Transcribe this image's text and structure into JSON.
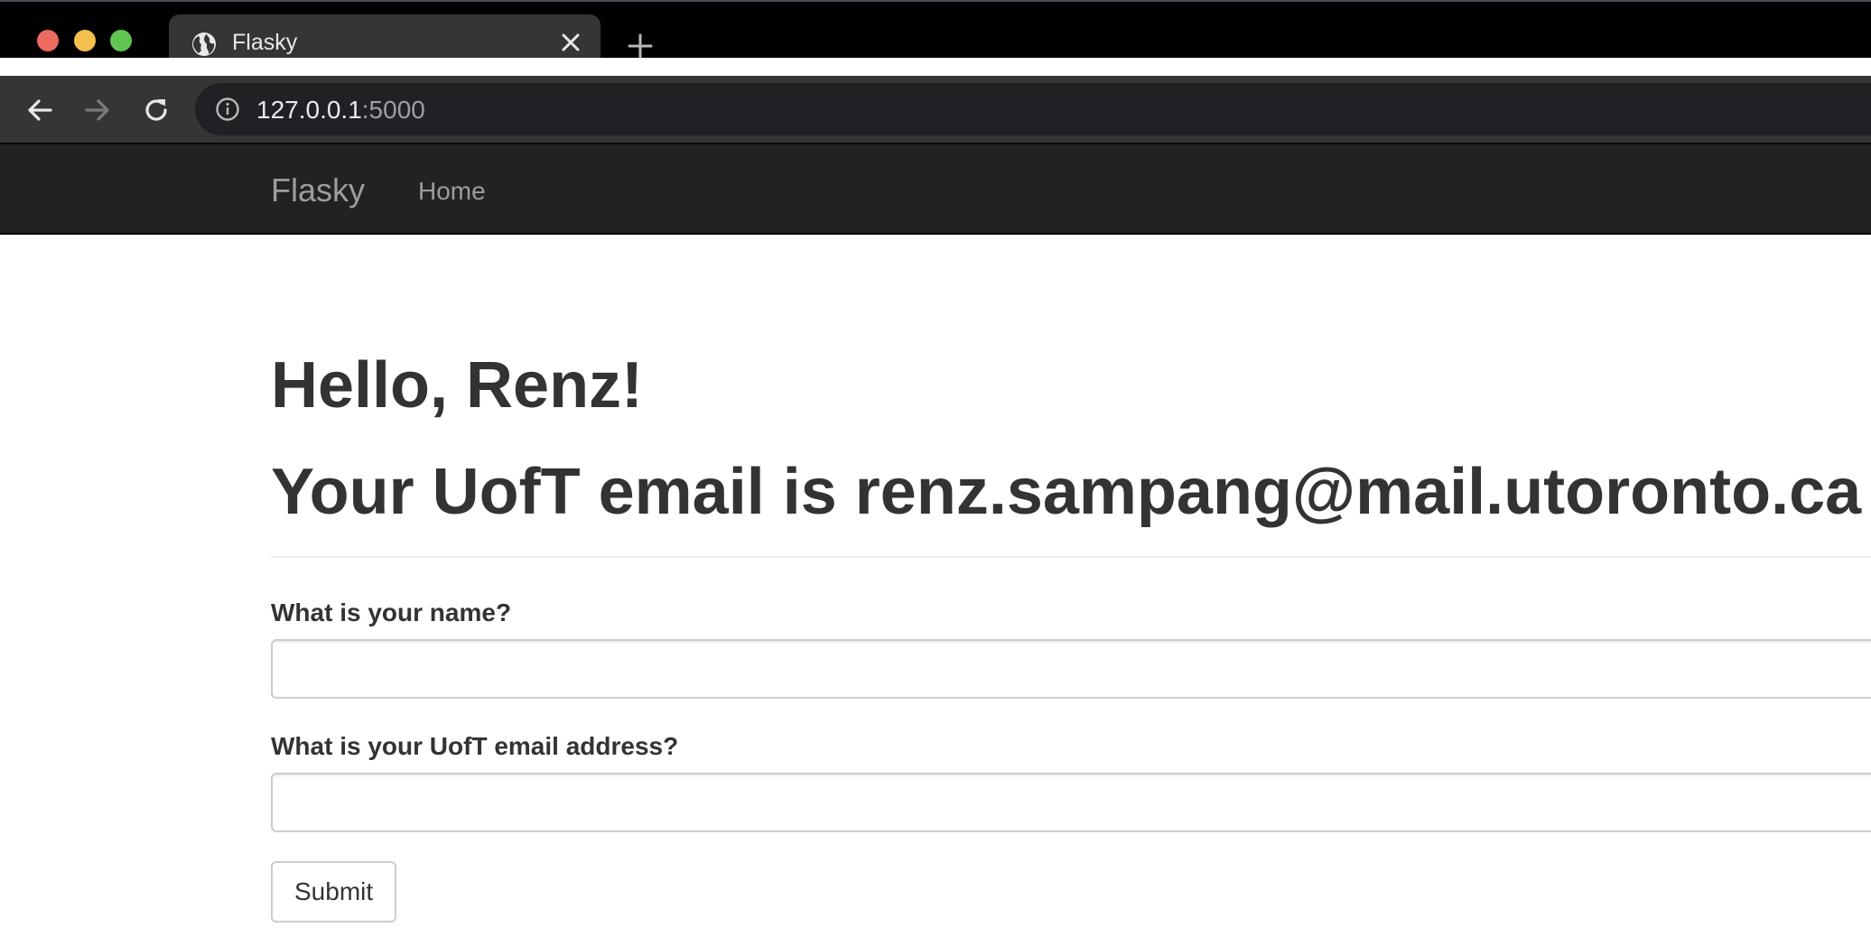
{
  "browser": {
    "tab_title": "Flasky",
    "url_host": "127.0.0.1",
    "url_port": ":5000",
    "icons": [
      "globe-icon",
      "close-icon",
      "plus-icon",
      "back-arrow-icon",
      "forward-arrow-icon",
      "reload-icon",
      "info-icon"
    ],
    "colors": {
      "traffic_red": "#ed6a5e",
      "traffic_yellow": "#f5bf4f",
      "traffic_green": "#61c554"
    }
  },
  "navbar": {
    "brand": "Flasky",
    "links": [
      {
        "label": "Home"
      }
    ],
    "background": "#222222"
  },
  "main": {
    "greeting": "Hello, Renz!",
    "email_heading": "Your UofT email is renz.sampang@mail.utoronto.ca",
    "form": {
      "name_label": "What is your name?",
      "name_value": "",
      "email_label": "What is your UofT email address?",
      "email_value": "",
      "submit_label": "Submit"
    }
  }
}
